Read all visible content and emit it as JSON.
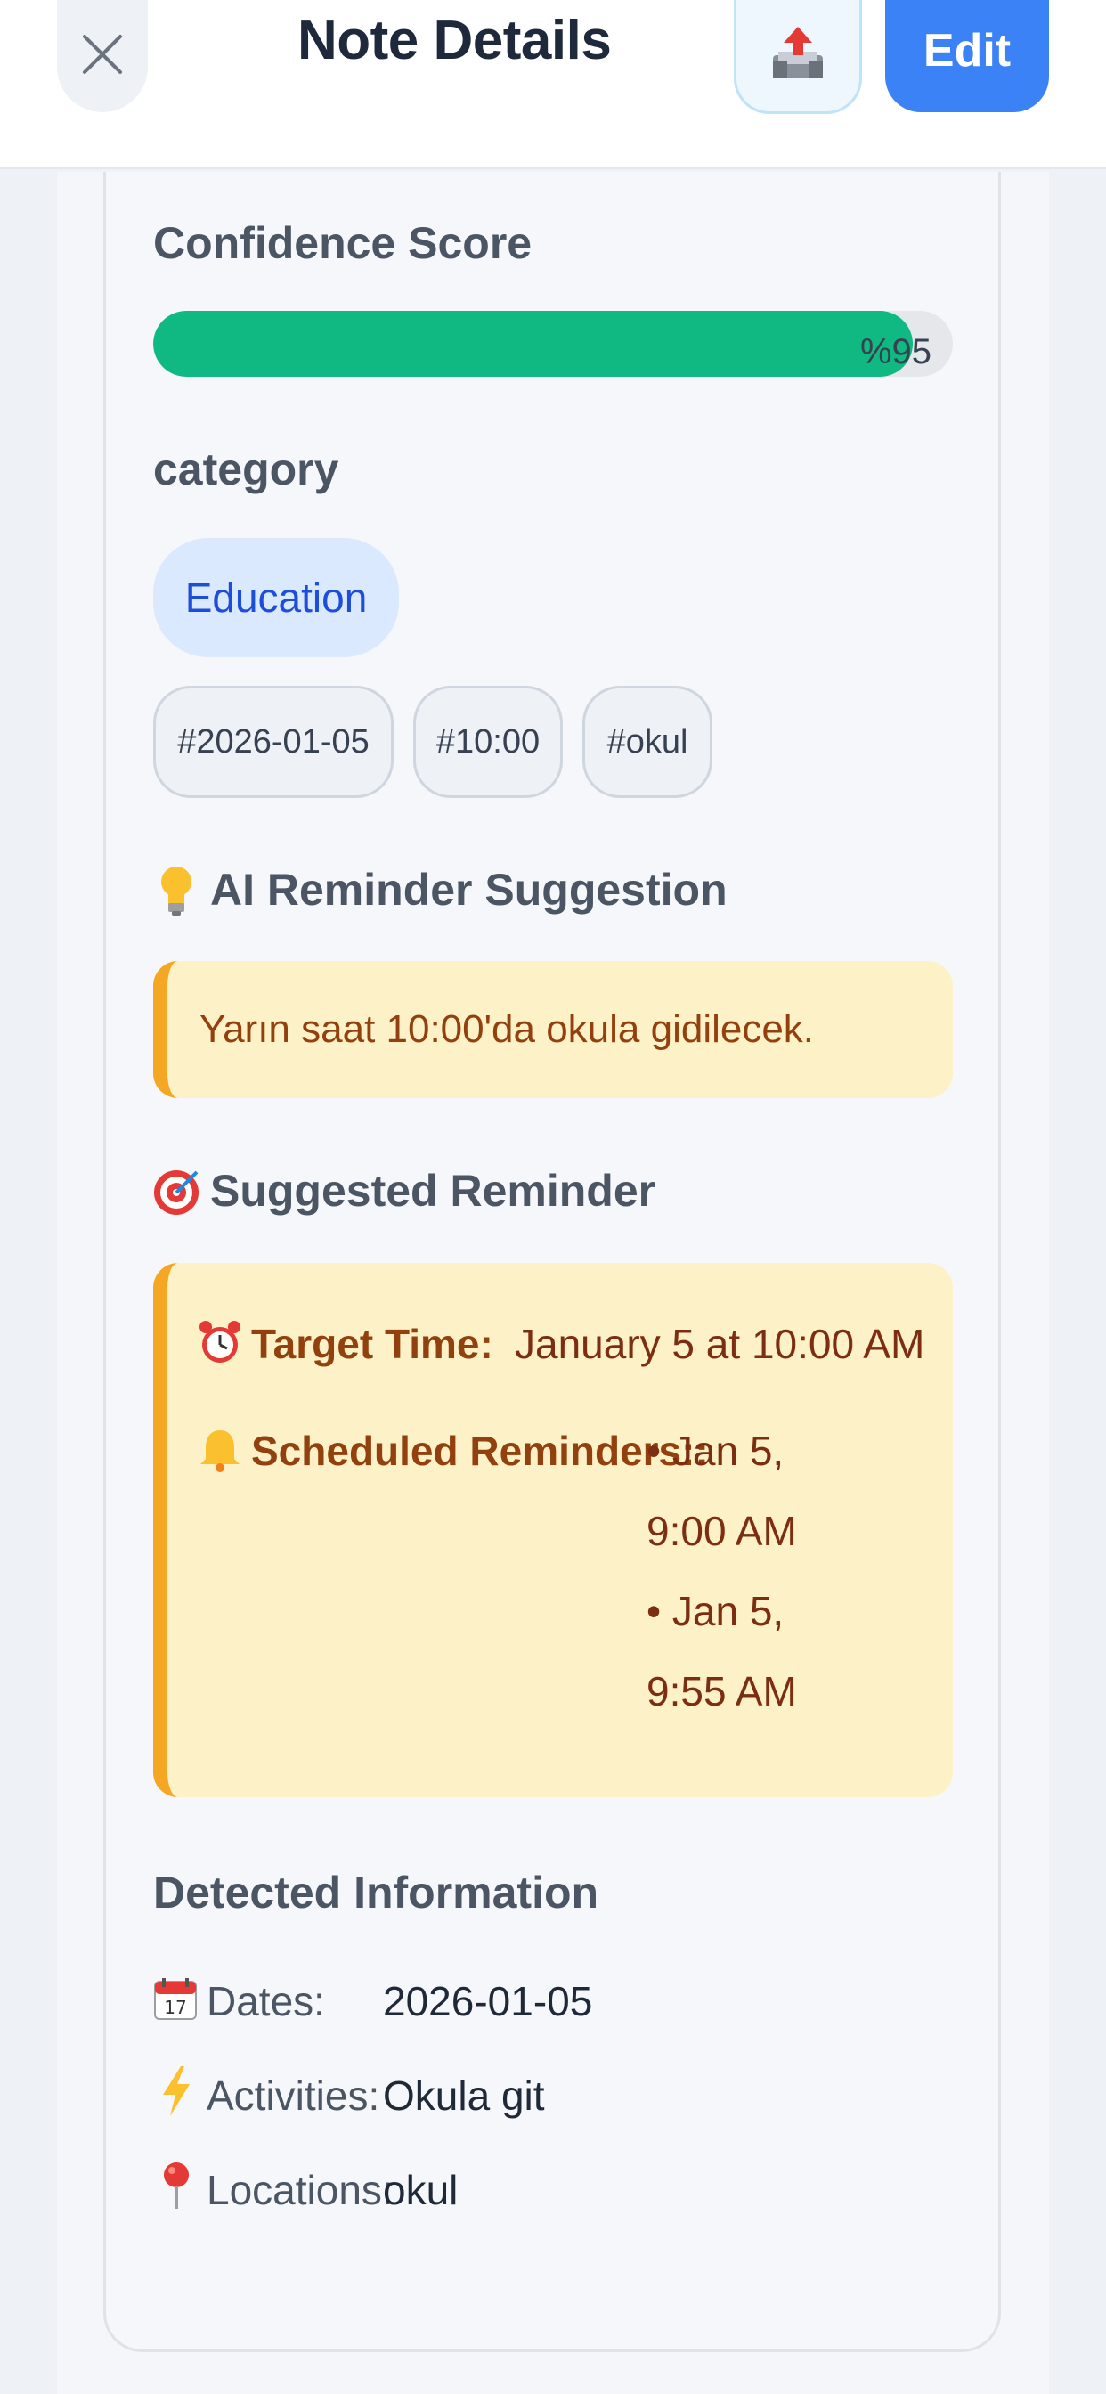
{
  "header": {
    "title": "Note Details",
    "edit_label": "Edit",
    "close_icon": "close-icon",
    "share_icon": "outbox-upload-icon"
  },
  "confidence": {
    "title": "Confidence Score",
    "value_percent": 95,
    "display": "%95",
    "bar_color": "#10b981"
  },
  "category": {
    "title": "category",
    "value": "Education"
  },
  "tags": [
    "#2026-01-05",
    "#10:00",
    "#okul"
  ],
  "ai_suggestion": {
    "icon": "lightbulb-icon",
    "title": "AI Reminder Suggestion",
    "text": "Yarın saat 10:00'da okula gidilecek."
  },
  "suggested_reminder": {
    "icon": "target-icon",
    "title": "Suggested Reminder",
    "target_label": "Target Time:",
    "target_value": "January 5 at 10:00 AM",
    "scheduled_label": "Scheduled Reminders::",
    "scheduled": [
      {
        "line1": "• Jan 5,",
        "line2": "9:00 AM"
      },
      {
        "line1": "• Jan 5,",
        "line2": "9:55 AM"
      }
    ]
  },
  "detected": {
    "title": "Detected Information",
    "dates_label": "Dates:",
    "dates_value": "2026-01-05",
    "activities_label": "Activities:",
    "activities_value": "Okula git",
    "locations_label": "Locations:",
    "locations_value": "okul"
  },
  "colors": {
    "accent": "#3b82f6",
    "warning_bg": "#fdf2c7",
    "warning_border": "#f5a623"
  }
}
